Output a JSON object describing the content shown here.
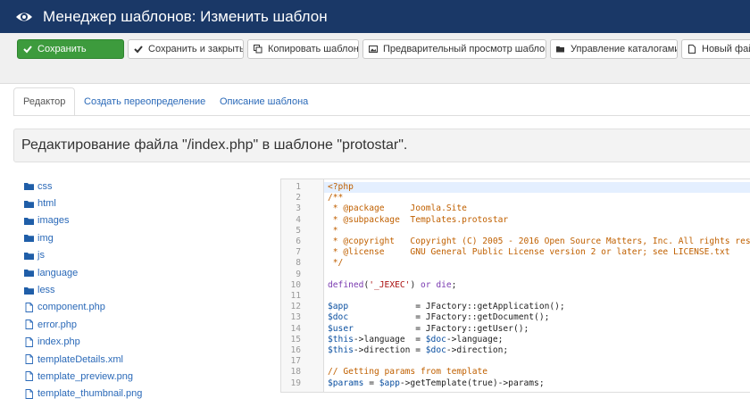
{
  "header": {
    "title": "Менеджер шаблонов: Изменить шаблон"
  },
  "toolbar": {
    "save": "Сохранить",
    "save_close": "Сохранить и закрыть",
    "copy": "Копировать шаблон",
    "preview": "Предварительный просмотр шаблона",
    "folders": "Управление каталогами",
    "new_file": "Новый фай"
  },
  "tabs": {
    "editor": "Редактор",
    "override": "Создать переопределение",
    "description": "Описание шаблона"
  },
  "file_title": "Редактирование файла \"/index.php\" в шаблоне \"protostar\".",
  "tree": {
    "folders": [
      "css",
      "html",
      "images",
      "img",
      "js",
      "language",
      "less"
    ],
    "files": [
      "component.php",
      "error.php",
      "index.php",
      "templateDetails.xml",
      "template_preview.png",
      "template_thumbnail.png"
    ]
  },
  "code": {
    "line_numbers": [
      "1",
      "2",
      "3",
      "4",
      "5",
      "6",
      "7",
      "8",
      "9",
      "10",
      "11",
      "12",
      "13",
      "14",
      "15",
      "16",
      "17",
      "18",
      "19"
    ],
    "lines": [
      [
        {
          "t": "<?php",
          "c": "comment"
        }
      ],
      [
        {
          "t": "/**",
          "c": "comment"
        }
      ],
      [
        {
          "t": " * @package     Joomla.Site",
          "c": "comment"
        }
      ],
      [
        {
          "t": " * @subpackage  Templates.protostar",
          "c": "comment"
        }
      ],
      [
        {
          "t": " *",
          "c": "comment"
        }
      ],
      [
        {
          "t": " * @copyright   Copyright (C) 2005 - 2016 Open Source Matters, Inc. All rights res",
          "c": "comment"
        }
      ],
      [
        {
          "t": " * @license     GNU General Public License version 2 or later; see LICENSE.txt",
          "c": "comment"
        }
      ],
      [
        {
          "t": " */",
          "c": "comment"
        }
      ],
      [],
      [
        {
          "t": "defined",
          "c": "kw"
        },
        {
          "t": "(",
          "c": "plain"
        },
        {
          "t": "'_JEXEC'",
          "c": "str"
        },
        {
          "t": ") ",
          "c": "plain"
        },
        {
          "t": "or die",
          "c": "kw"
        },
        {
          "t": ";",
          "c": "plain"
        }
      ],
      [],
      [
        {
          "t": "$app",
          "c": "var"
        },
        {
          "t": "             = JFactory::getApplication();",
          "c": "plain"
        }
      ],
      [
        {
          "t": "$doc",
          "c": "var"
        },
        {
          "t": "             = JFactory::getDocument();",
          "c": "plain"
        }
      ],
      [
        {
          "t": "$user",
          "c": "var"
        },
        {
          "t": "            = JFactory::getUser();",
          "c": "plain"
        }
      ],
      [
        {
          "t": "$this",
          "c": "var"
        },
        {
          "t": "->language  = ",
          "c": "plain"
        },
        {
          "t": "$doc",
          "c": "var"
        },
        {
          "t": "->language;",
          "c": "plain"
        }
      ],
      [
        {
          "t": "$this",
          "c": "var"
        },
        {
          "t": "->direction = ",
          "c": "plain"
        },
        {
          "t": "$doc",
          "c": "var"
        },
        {
          "t": "->direction;",
          "c": "plain"
        }
      ],
      [],
      [
        {
          "t": "// Getting params from template",
          "c": "comment"
        }
      ],
      [
        {
          "t": "$params",
          "c": "var"
        },
        {
          "t": " = ",
          "c": "plain"
        },
        {
          "t": "$app",
          "c": "var"
        },
        {
          "t": "->getTemplate(true)->params;",
          "c": "plain"
        }
      ]
    ]
  },
  "colors": {
    "header_bg": "#1a3867",
    "save_green": "#3d9b3d",
    "link_blue": "#2a69b8"
  },
  "icons": {
    "header": "eye-icon",
    "save": "check-icon",
    "save_close": "check-icon",
    "copy": "copy-icon",
    "preview": "image-icon",
    "folders": "folder-open-icon",
    "new_file": "file-icon"
  }
}
